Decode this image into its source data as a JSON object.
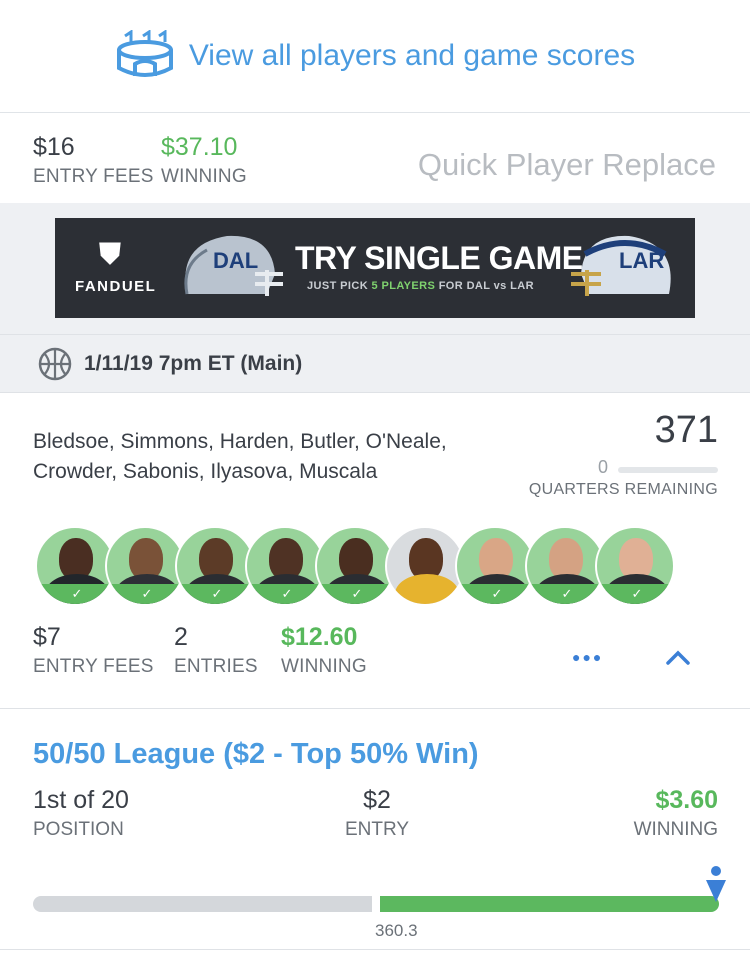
{
  "header": {
    "link_label": "View all players and game scores",
    "link_icon": "stadium-icon"
  },
  "summary": {
    "entry_fees": "$16",
    "entry_fees_label": "ENTRY FEES",
    "winning": "$37.10",
    "winning_label": "WINNING",
    "quick_replace": "Quick Player Replace"
  },
  "banner": {
    "brand": "FANDUEL",
    "headline": "TRY SINGLE GAME:",
    "sub_pre": "JUST PICK ",
    "sub_hl": "5 PLAYERS",
    "sub_post": " FOR DAL vs LAR",
    "team_left": "DAL",
    "team_right": "LAR"
  },
  "slate": {
    "icon": "basketball-icon",
    "label": "1/11/19 7pm ET (Main)"
  },
  "lineup": {
    "players": "Bledsoe, Simmons, Harden, Butler, O'Neale, Crowder, Sabonis, Ilyasova, Muscala",
    "score": "371",
    "quarters_remaining": "0",
    "quarters_label": "QUARTERS REMAINING",
    "entry_fees": "$7",
    "entry_fees_label": "ENTRY FEES",
    "entries": "2",
    "entries_label": "ENTRIES",
    "winning": "$12.60",
    "winning_label": "WINNING",
    "avatars": [
      {
        "name": "Bledsoe",
        "check": true
      },
      {
        "name": "Simmons",
        "check": true
      },
      {
        "name": "Harden",
        "check": true
      },
      {
        "name": "Butler",
        "check": true
      },
      {
        "name": "O'Neale",
        "check": true
      },
      {
        "name": "Crowder",
        "check": false
      },
      {
        "name": "Sabonis",
        "check": true
      },
      {
        "name": "Ilyasova",
        "check": true
      },
      {
        "name": "Muscala",
        "check": true
      }
    ]
  },
  "contest": {
    "title": "50/50 League ($2 - Top 50% Win)",
    "position": "1st of 20",
    "position_label": "POSITION",
    "entry": "$2",
    "entry_label": "ENTRY",
    "winning": "$3.60",
    "winning_label": "WINNING",
    "threshold": "360.3",
    "progress_fraction": 0.5
  },
  "colors": {
    "accent": "#4a9be0",
    "green": "#5cb85f",
    "text": "#3a3f47"
  }
}
